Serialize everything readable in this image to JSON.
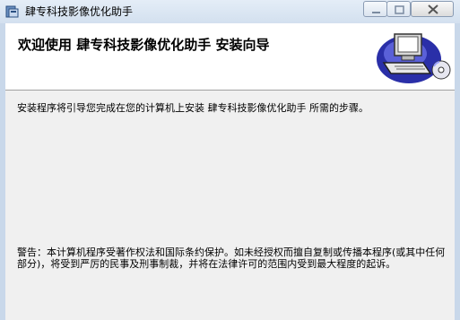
{
  "window": {
    "title": "肆专科技影像优化助手"
  },
  "header": {
    "heading": "欢迎使用  肆专科技影像优化助手  安装向导"
  },
  "body": {
    "intro": "安装程序将引导您完成在您的计算机上安装  肆专科技影像优化助手  所需的步骤。",
    "warning": "警告：本计算机程序受著作权法和国际条约保护。如未经授权而擅自复制或传播本程序(或其中任何部分)，将受到严厉的民事及刑事制裁，并将在法律许可的范围内受到最大程度的起诉。"
  },
  "icons": {
    "app": "installer-app-icon",
    "wizard": "computer-cd-icon"
  }
}
